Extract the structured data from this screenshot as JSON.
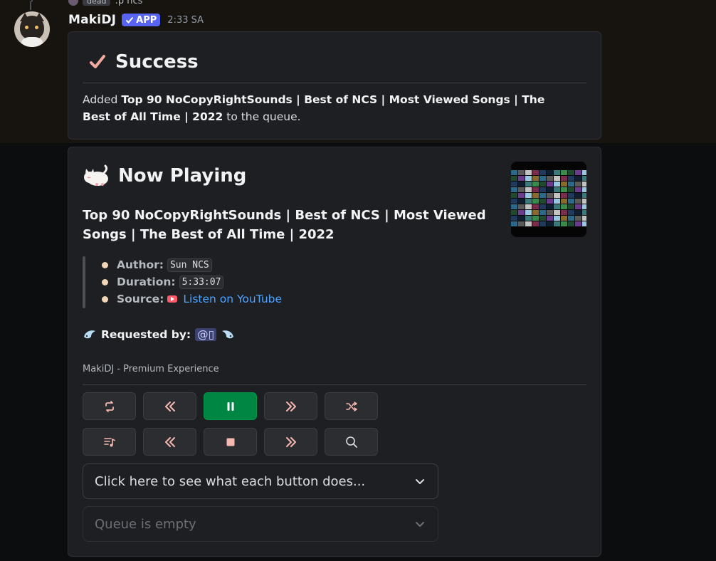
{
  "reply": {
    "badge": "dead",
    "text": ":p ncs"
  },
  "message": {
    "username": "MakiDJ",
    "app_badge": "APP",
    "timestamp": "2:33 SA"
  },
  "success_embed": {
    "icon": "check-icon",
    "title": "Success",
    "prefix": "Added ",
    "song": "Top 90 NoCopyRightSounds | Best of NCS | Most Viewed Songs | The Best of All Time | 2022",
    "suffix": " to the queue."
  },
  "now_playing_embed": {
    "icon": "sleeping-cat-icon",
    "title": "Now Playing",
    "song_title": "Top 90 NoCopyRightSounds | Best of NCS | Most Viewed Songs | The Best of All Time | 2022",
    "author_label": "Author:",
    "author": "Sun NCS",
    "duration_label": "Duration:",
    "duration": "5:33:07",
    "source_label": "Source:",
    "source_link": "Listen on YouTube",
    "requested_label": "Requested by:",
    "requester": "@▯",
    "footer": "MakiDJ - Premium Experience"
  },
  "controls": {
    "row1": [
      "loop-icon",
      "rewind-icon",
      "pause-icon",
      "fast-forward-icon",
      "shuffle-icon"
    ],
    "row2": [
      "playlist-icon",
      "previous-icon",
      "stop-icon",
      "next-icon",
      "search-icon"
    ]
  },
  "selects": {
    "help_placeholder": "Click here to see what each button does...",
    "queue_placeholder": "Queue is empty"
  },
  "colors": {
    "accent": "#5865f2",
    "play_button": "#008643",
    "link": "#4fa3ff",
    "icon_tint": "#f6b8b0"
  }
}
